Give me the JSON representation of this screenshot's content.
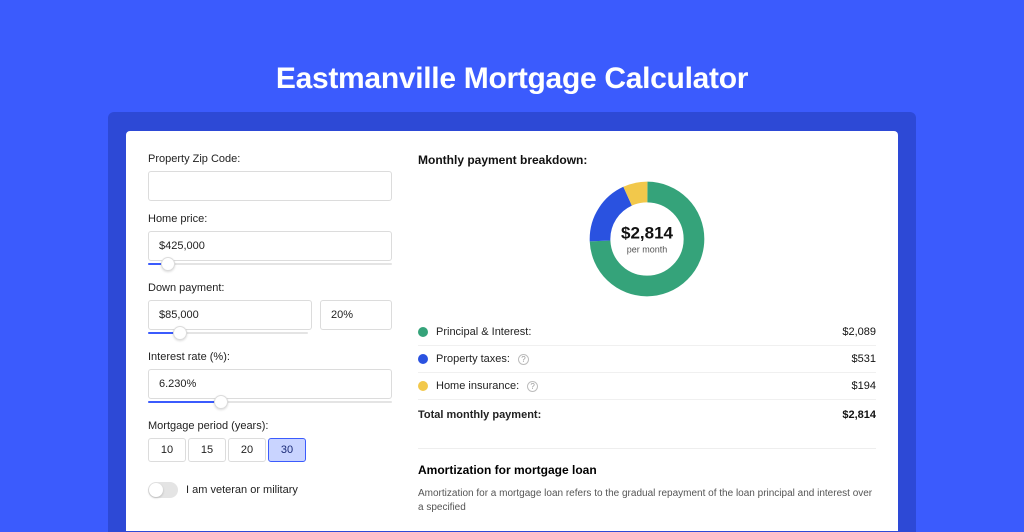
{
  "title": "Eastmanville Mortgage Calculator",
  "left": {
    "zip": {
      "label": "Property Zip Code:",
      "value": ""
    },
    "price": {
      "label": "Home price:",
      "value": "$425,000",
      "slider_pct": 8
    },
    "down": {
      "label": "Down payment:",
      "value": "$85,000",
      "pct_value": "20%",
      "slider_pct": 20
    },
    "rate": {
      "label": "Interest rate (%):",
      "value": "6.230%",
      "slider_pct": 30
    },
    "period": {
      "label": "Mortgage period (years):",
      "options": [
        "10",
        "15",
        "20",
        "30"
      ],
      "active": "30"
    },
    "veteran": {
      "label": "I am veteran or military",
      "on": false
    }
  },
  "right": {
    "breakdown_title": "Monthly payment breakdown:",
    "total": {
      "value": "$2,814",
      "sub": "per month"
    },
    "chart_data": {
      "type": "pie",
      "series": [
        {
          "name": "Principal & Interest",
          "value": 2089,
          "color": "#35a37a"
        },
        {
          "name": "Property taxes",
          "value": 531,
          "color": "#2a52e0"
        },
        {
          "name": "Home insurance",
          "value": 194,
          "color": "#f2c84b"
        }
      ]
    },
    "legend": {
      "pi": {
        "label": "Principal & Interest:",
        "value": "$2,089",
        "color": "#35a37a",
        "info": false
      },
      "tax": {
        "label": "Property taxes:",
        "value": "$531",
        "color": "#2a52e0",
        "info": true
      },
      "ins": {
        "label": "Home insurance:",
        "value": "$194",
        "color": "#f2c84b",
        "info": true
      }
    },
    "total_row": {
      "label": "Total monthly payment:",
      "value": "$2,814"
    },
    "amort": {
      "title": "Amortization for mortgage loan",
      "body": "Amortization for a mortgage loan refers to the gradual repayment of the loan principal and interest over a specified"
    }
  }
}
